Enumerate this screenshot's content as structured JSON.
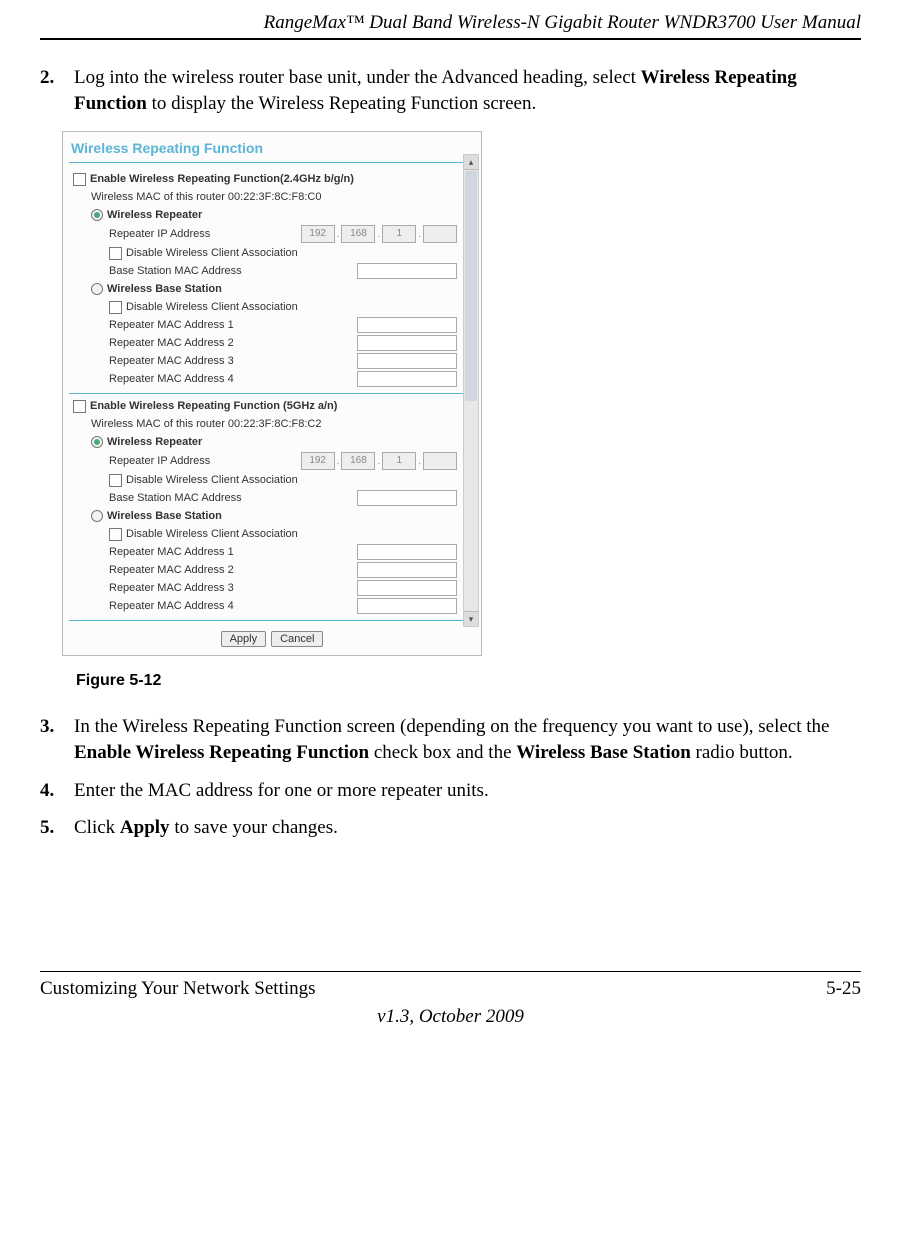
{
  "header": {
    "title": "RangeMax™ Dual Band Wireless-N Gigabit Router WNDR3700 User Manual"
  },
  "steps": {
    "s2_num": "2.",
    "s2_a": "Log into the wireless router base unit, under the Advanced heading, select ",
    "s2_b": "Wireless Repeating Function",
    "s2_c": " to display the Wireless Repeating Function screen.",
    "s3_num": "3.",
    "s3_a": "In the Wireless Repeating Function screen (depending on the frequency you want to use), select the ",
    "s3_b": "Enable Wireless Repeating Function",
    "s3_c": " check box and the ",
    "s3_d": "Wireless Base Station",
    "s3_e": " radio button.",
    "s4_num": "4.",
    "s4_a": "Enter the MAC address for one or more repeater units.",
    "s5_num": "5.",
    "s5_a": "Click ",
    "s5_b": "Apply",
    "s5_c": " to save your changes."
  },
  "figure": {
    "caption": "Figure 5-12",
    "title": "Wireless Repeating Function",
    "band24": {
      "enable": "Enable Wireless Repeating Function(2.4GHz b/g/n)",
      "mac_label": "Wireless MAC of this router 00:22:3F:8C:F8:C0",
      "repeater_radio": "Wireless Repeater",
      "rep_ip": "Repeater IP Address",
      "ip1": "192",
      "ip2": "168",
      "ip3": "1",
      "ip4": "",
      "disable_assoc": "Disable Wireless Client Association",
      "base_mac": "Base Station MAC Address",
      "base_radio": "Wireless Base Station",
      "rep1": "Repeater MAC Address 1",
      "rep2": "Repeater MAC Address 2",
      "rep3": "Repeater MAC Address 3",
      "rep4": "Repeater MAC Address 4"
    },
    "band5": {
      "enable": "Enable Wireless Repeating Function (5GHz a/n)",
      "mac_label": "Wireless MAC of this router 00:22:3F:8C:F8:C2",
      "repeater_radio": "Wireless Repeater",
      "rep_ip": "Repeater IP Address",
      "ip1": "192",
      "ip2": "168",
      "ip3": "1",
      "ip4": "",
      "disable_assoc": "Disable Wireless Client Association",
      "base_mac": "Base Station MAC Address",
      "base_radio": "Wireless Base Station",
      "rep1": "Repeater MAC Address 1",
      "rep2": "Repeater MAC Address 2",
      "rep3": "Repeater MAC Address 3",
      "rep4": "Repeater MAC Address 4"
    },
    "buttons": {
      "apply": "Apply",
      "cancel": "Cancel"
    }
  },
  "footer": {
    "left": "Customizing Your Network Settings",
    "right": "5-25",
    "version": "v1.3, October 2009"
  }
}
